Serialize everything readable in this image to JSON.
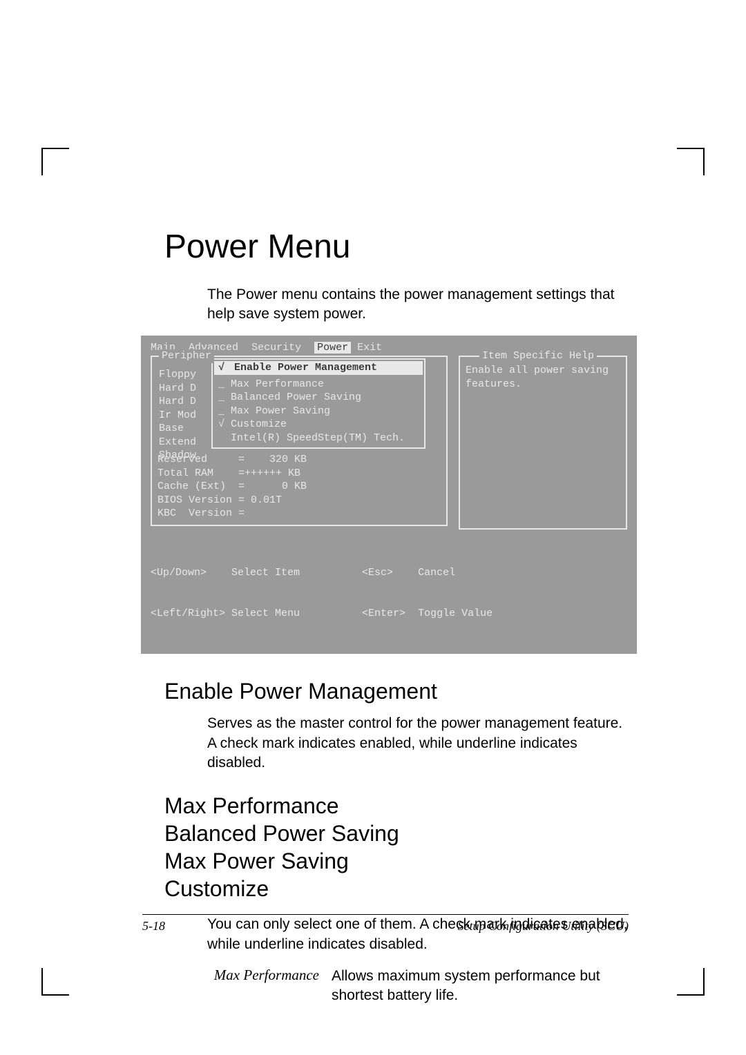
{
  "title": "Power Menu",
  "intro": "The Power menu contains the power management settings that help save system power.",
  "bios": {
    "menubar": {
      "items": [
        "Main",
        "Advanced",
        "Security",
        "Power",
        "Exit"
      ],
      "selected": "Power"
    },
    "periph_label": "Peripher",
    "left_labels": [
      "Floppy",
      "Hard D",
      "Hard D",
      "Ir Mod",
      "",
      "Base",
      "Extend",
      "Shadow"
    ],
    "popup": {
      "check": "√",
      "title": "Enable Power Management",
      "items": [
        "_ Max Performance",
        "_ Balanced Power Saving",
        "_ Max Power Saving",
        "√ Customize",
        "",
        "  Intel(R) SpeedStep(TM) Tech."
      ]
    },
    "after": [
      "Reserved     =    320 KB",
      "Total RAM    =++++++ KB",
      "Cache (Ext)  =      0 KB",
      "BIOS Version = 0.01T",
      "KBC  Version ="
    ],
    "help": {
      "label": "Item Specific Help",
      "line1": "Enable all power saving",
      "line2": "features."
    },
    "footer1": "<Up/Down>    Select Item          <Esc>    Cancel",
    "footer2": "<Left/Right> Select Menu          <Enter>  Toggle Value"
  },
  "section_enable": {
    "heading": "Enable Power Management",
    "body": "Serves as the master control for the power management feature. A check mark indicates enabled, while underline indicates disabled."
  },
  "group": {
    "h1": "Max Performance",
    "h2": "Balanced Power Saving",
    "h3": "Max Power Saving",
    "h4": "Customize",
    "body": "You can only select one of them. A check mark indicates enabled, while underline indicates disabled.",
    "term": "Max Performance",
    "desc": "Allows maximum system performance but shortest battery life."
  },
  "footer": {
    "page": "5-18",
    "doc": "Setup Configuration Utility (SCU)"
  }
}
